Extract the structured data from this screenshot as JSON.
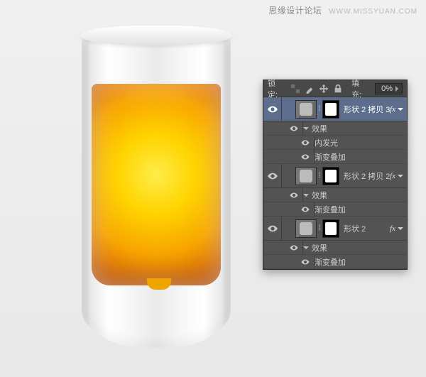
{
  "watermark": {
    "cn": "思缘设计论坛",
    "en": "WWW.MISSYUAN.COM"
  },
  "panel": {
    "lock_label": "锁定:",
    "fill_label": "填充:",
    "fill_value": "0%"
  },
  "layers": [
    {
      "name": "形状 2 拷贝 3",
      "selected": true,
      "has_fx": true,
      "effects_label": "效果",
      "effects": [
        "内发光",
        "渐变叠加"
      ]
    },
    {
      "name": "形状 2 拷贝 2",
      "selected": false,
      "has_fx": true,
      "effects_label": "效果",
      "effects": [
        "渐变叠加"
      ]
    },
    {
      "name": "形状 2",
      "selected": false,
      "has_fx": true,
      "effects_label": "效果",
      "effects": [
        "渐变叠加"
      ]
    }
  ]
}
